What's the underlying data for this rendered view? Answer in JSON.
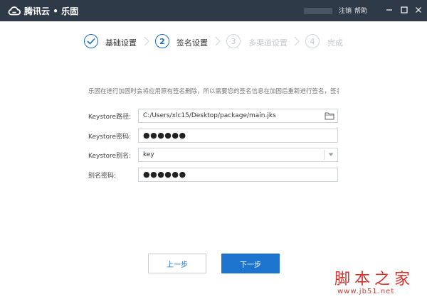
{
  "app": {
    "brand_name": "腾讯云",
    "separator": "•",
    "product_name": "乐固"
  },
  "titlebar": {
    "logout": "注销",
    "help": "帮助",
    "minimize_icon": "minimize-icon",
    "maximize_icon": "maximize-icon",
    "close_icon": "close-icon"
  },
  "steps": [
    {
      "marker": "✓",
      "label": "基础设置",
      "state": "done"
    },
    {
      "marker": "2",
      "label": "签名设置",
      "state": "active"
    },
    {
      "marker": "3",
      "label": "多渠道设置",
      "state": "pending"
    },
    {
      "marker": "4",
      "label": "完成",
      "state": "pending"
    }
  ],
  "notice": "乐固在进行加固时会将应用原有签名删除，所以需要您的签名信息在加固后重新进行签名，签名只",
  "form": {
    "keystore_path": {
      "label": "Keystore路径:",
      "value": "C:/Users/xlc15/Desktop/package/main.jks"
    },
    "keystore_password": {
      "label": "Keystore密码:",
      "value": "●●●●●●"
    },
    "keystore_alias": {
      "label": "Keystore别名:",
      "value": "key"
    },
    "alias_password": {
      "label": "别名密码:",
      "value": "●●●●●●"
    }
  },
  "buttons": {
    "prev": "上一步",
    "next": "下一步"
  },
  "watermark": {
    "main": "脚本之家",
    "url": "www.jb51.net"
  },
  "colors": {
    "titlebar_bg": "#2f3a48",
    "accent": "#1d74cf",
    "step_active": "#1a6fc2",
    "step_inactive": "#c4c8cd",
    "watermark": "#d8322c"
  }
}
